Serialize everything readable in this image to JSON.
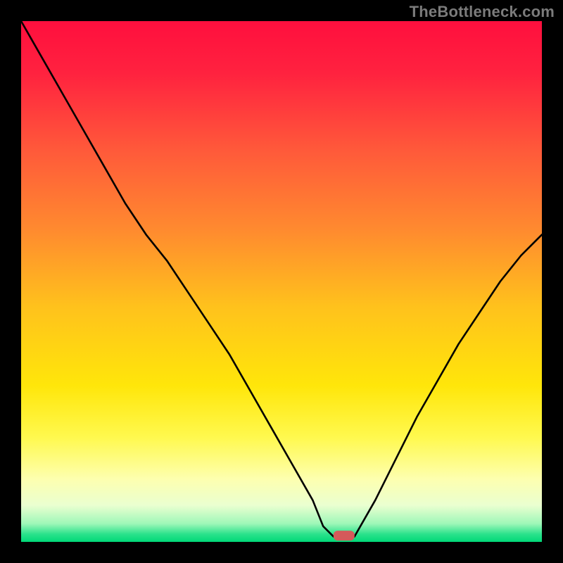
{
  "watermark": "TheBottleneck.com",
  "chart_data": {
    "type": "line",
    "title": "",
    "xlabel": "",
    "ylabel": "",
    "xlim": [
      0,
      100
    ],
    "ylim": [
      0,
      100
    ],
    "grid": false,
    "legend": false,
    "note": "Axis values are estimated from the unlabeled plot as 0–100 percent.",
    "marker": {
      "x": 62,
      "y": 1.2,
      "color": "#d45a5a",
      "shape": "rounded-rect"
    },
    "series": [
      {
        "name": "bottleneck-curve",
        "color": "#000000",
        "x": [
          0,
          4,
          8,
          12,
          16,
          20,
          24,
          28,
          32,
          36,
          40,
          44,
          48,
          52,
          56,
          58,
          60,
          62,
          64,
          68,
          72,
          76,
          80,
          84,
          88,
          92,
          96,
          100
        ],
        "y": [
          100,
          93,
          86,
          79,
          72,
          65,
          59,
          54,
          48,
          42,
          36,
          29,
          22,
          15,
          8,
          3,
          1,
          1,
          1,
          8,
          16,
          24,
          31,
          38,
          44,
          50,
          55,
          59
        ]
      }
    ],
    "background_gradient": {
      "type": "vertical",
      "stops": [
        {
          "pos": 0.0,
          "color": "#ff0f3e"
        },
        {
          "pos": 0.1,
          "color": "#ff223f"
        },
        {
          "pos": 0.25,
          "color": "#ff5a3a"
        },
        {
          "pos": 0.4,
          "color": "#ff8a2f"
        },
        {
          "pos": 0.55,
          "color": "#ffc21c"
        },
        {
          "pos": 0.7,
          "color": "#ffe60a"
        },
        {
          "pos": 0.8,
          "color": "#fff94f"
        },
        {
          "pos": 0.88,
          "color": "#fdffb0"
        },
        {
          "pos": 0.93,
          "color": "#eaffd0"
        },
        {
          "pos": 0.965,
          "color": "#9ef7b8"
        },
        {
          "pos": 0.985,
          "color": "#2be28c"
        },
        {
          "pos": 1.0,
          "color": "#00d877"
        }
      ]
    }
  }
}
